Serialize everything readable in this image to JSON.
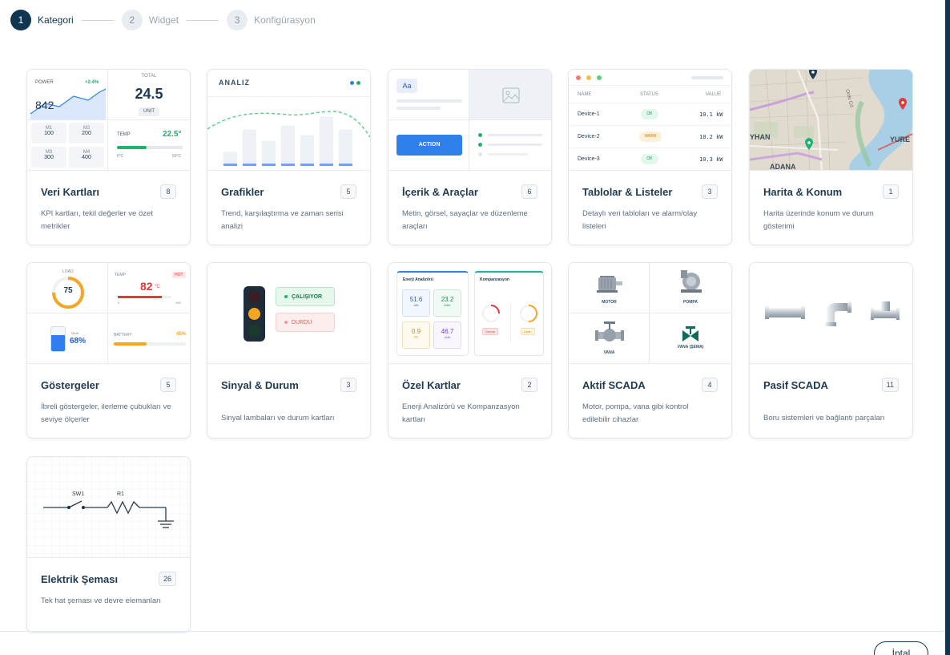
{
  "stepper": {
    "steps": [
      {
        "num": "1",
        "label": "Kategori"
      },
      {
        "num": "2",
        "label": "Widget"
      },
      {
        "num": "3",
        "label": "Konfigürasyon"
      }
    ]
  },
  "categories": [
    {
      "title": "Veri Kartları",
      "count": "8",
      "desc": "KPI kartları, tekil değerler ve özet metrikler"
    },
    {
      "title": "Grafikler",
      "count": "5",
      "desc": "Trend, karşılaştırma ve zaman serisi analizi"
    },
    {
      "title": "İçerik & Araçlar",
      "count": "6",
      "desc": "Metin, görsel, sayaçlar ve düzenleme araçları"
    },
    {
      "title": "Tablolar & Listeler",
      "count": "3",
      "desc": "Detaylı veri tabloları ve alarm/olay listeleri"
    },
    {
      "title": "Harita & Konum",
      "count": "1",
      "desc": "Harita üzerinde konum ve durum gösterimi"
    },
    {
      "title": "Göstergeler",
      "count": "5",
      "desc": "İbreli göstergeler, ilerleme çubukları ve seviye ölçerler"
    },
    {
      "title": "Sinyal & Durum",
      "count": "3",
      "desc": "Sinyal lambaları ve durum kartları"
    },
    {
      "title": "Özel Kartlar",
      "count": "2",
      "desc": "Enerji Analizörü ve Kompanzasyon kartları"
    },
    {
      "title": "Aktif SCADA",
      "count": "4",
      "desc": "Motor, pompa, vana gibi kontrol edilebilir cihazlar"
    },
    {
      "title": "Pasif SCADA",
      "count": "11",
      "desc": "Boru sistemleri ve bağlantı parçaları"
    },
    {
      "title": "Elektrik Şeması",
      "count": "26",
      "desc": "Tek hat şeması ve devre elemanları"
    }
  ],
  "previews": {
    "kpi": {
      "power_label": "POWER",
      "power_change": "+2.4%",
      "power_value": "842",
      "total_label": "TOTAL",
      "total_value": "24.5",
      "unit": "UNIT",
      "m1_label": "M1",
      "m1_value": "100",
      "m2_label": "M2",
      "m2_value": "200",
      "m3_label": "M3",
      "m3_value": "300",
      "m4_label": "M4",
      "m4_value": "400",
      "temp_label": "TEMP",
      "temp_value": "22.5°",
      "temp_min": "0°C",
      "temp_max": "50°C"
    },
    "chart": {
      "title": "ANALIZ",
      "bars": [
        0.25,
        0.65,
        0.45,
        0.72,
        0.55,
        0.88,
        0.65
      ]
    },
    "content": {
      "text_chip": "Aa",
      "action_label": "ACTION"
    },
    "table": {
      "headers": [
        "NAME",
        "STATUS",
        "VALUE"
      ],
      "rows": [
        {
          "name": "Device-1",
          "status": "OK",
          "value": "10.1 kW"
        },
        {
          "name": "Device-2",
          "status": "WARN",
          "value": "10.2 kW"
        },
        {
          "name": "Device-3",
          "status": "OK",
          "value": "10.3 kW"
        }
      ]
    },
    "map": {
      "label_1": "YHAN",
      "label_2": "YURE",
      "label_3": "ADANA",
      "street": "Ordu Cd."
    },
    "gauges": {
      "load_label": "LOAD",
      "load_value": "75",
      "load_level": 0.75,
      "temp_label": "TEMP",
      "temp_value": "82",
      "temp_unit": "°C",
      "hot_badge": "HOT",
      "temp_min": "0",
      "temp_max": "100",
      "temp_level": 0.82,
      "tank_label": "TANK",
      "tank_value": "68%",
      "tank_level": 0.68,
      "battery_label": "BATTERY",
      "battery_value": "45%",
      "battery_level": 0.45
    },
    "signal": {
      "running": "ÇALIŞIYOR",
      "stopped": "DURDU"
    },
    "special": {
      "energy_title": "Enerji Analizörü",
      "v1": "51.6",
      "u1": "kW",
      "v2": "23.2",
      "u2": "kWh",
      "v3": "0.9",
      "u3": "PF",
      "v4": "46.7",
      "u4": "kVA",
      "comp_title": "Kompanzasyon",
      "badge1": "Durum",
      "badge2": "Uyarı"
    },
    "scada": {
      "motor": "MOTOR",
      "pump": "POMPA",
      "valve": "VANA",
      "valve_schema": "VANA (ŞEMA)"
    },
    "electric": {
      "sw_label": "SW1",
      "r_label": "R1"
    }
  },
  "footer": {
    "cancel_label": "İptal"
  },
  "colors": {
    "primary": "#0f3550",
    "green": "#1db36a",
    "accent_blue": "#2f80ed",
    "red": "#e03b3b",
    "orange": "#f5a623"
  }
}
